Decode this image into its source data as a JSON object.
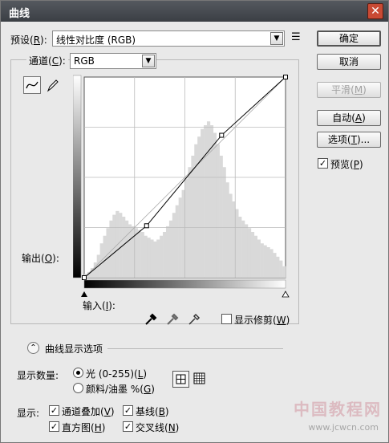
{
  "window": {
    "title": "曲线",
    "close_symbol": "✕"
  },
  "preset": {
    "label_prefix": "预设(",
    "label_key": "R",
    "label_suffix": "):",
    "value": "线性对比度 (RGB)",
    "menu_symbol": "☰"
  },
  "channel": {
    "label_prefix": "通道(",
    "label_key": "C",
    "label_suffix": "):",
    "value": "RGB"
  },
  "buttons": {
    "ok": "确定",
    "cancel": "取消",
    "smooth_prefix": "平滑(",
    "smooth_key": "M",
    "smooth_suffix": ")",
    "auto_prefix": "自动(",
    "auto_key": "A",
    "auto_suffix": ")",
    "options_prefix": "选项(",
    "options_key": "T",
    "options_suffix": ")..."
  },
  "preview": {
    "prefix": "预览(",
    "key": "P",
    "suffix": ")",
    "checked": true
  },
  "graph_labels": {
    "output_prefix": "输出(",
    "output_key": "O",
    "output_suffix": "):",
    "input_prefix": "输入(",
    "input_key": "I",
    "input_suffix": "):"
  },
  "show_clipping": {
    "prefix": "显示修剪(",
    "key": "W",
    "suffix": ")",
    "checked": false
  },
  "display_options": {
    "title": "曲线显示选项",
    "toggle_symbol": "⌃"
  },
  "display_amount": {
    "label": "显示数量:",
    "light_prefix": "光 (0-255)(",
    "light_key": "L",
    "light_suffix": ")",
    "pigment_prefix": "颜料/油墨 %(",
    "pigment_key": "G",
    "pigment_suffix": ")",
    "selected": "light"
  },
  "show": {
    "label": "显示:",
    "channel_overlay": {
      "prefix": "通道叠加(",
      "key": "V",
      "suffix": ")",
      "checked": true
    },
    "baseline": {
      "prefix": "基线(",
      "key": "B",
      "suffix": ")",
      "checked": true
    },
    "histogram": {
      "prefix": "直方图(",
      "key": "H",
      "suffix": ")",
      "checked": true
    },
    "intersection": {
      "prefix": "交叉线(",
      "key": "N",
      "suffix": ")",
      "checked": true
    }
  },
  "curve": {
    "points": [
      [
        0,
        0
      ],
      [
        79,
        66
      ],
      [
        174,
        181
      ],
      [
        255,
        255
      ]
    ]
  },
  "histogram": {
    "values": [
      0.02,
      0.03,
      0.05,
      0.08,
      0.12,
      0.18,
      0.22,
      0.26,
      0.3,
      0.33,
      0.35,
      0.34,
      0.32,
      0.3,
      0.28,
      0.27,
      0.26,
      0.25,
      0.24,
      0.22,
      0.21,
      0.2,
      0.19,
      0.2,
      0.22,
      0.24,
      0.27,
      0.3,
      0.34,
      0.38,
      0.42,
      0.46,
      0.52,
      0.58,
      0.64,
      0.7,
      0.74,
      0.78,
      0.8,
      0.82,
      0.8,
      0.76,
      0.7,
      0.64,
      0.58,
      0.5,
      0.44,
      0.4,
      0.36,
      0.32,
      0.3,
      0.28,
      0.26,
      0.24,
      0.22,
      0.2,
      0.18,
      0.17,
      0.16,
      0.15,
      0.13,
      0.11,
      0.09,
      0.06
    ]
  },
  "watermark": {
    "text": "中国教程网",
    "url": "www.jcwcn.com"
  }
}
